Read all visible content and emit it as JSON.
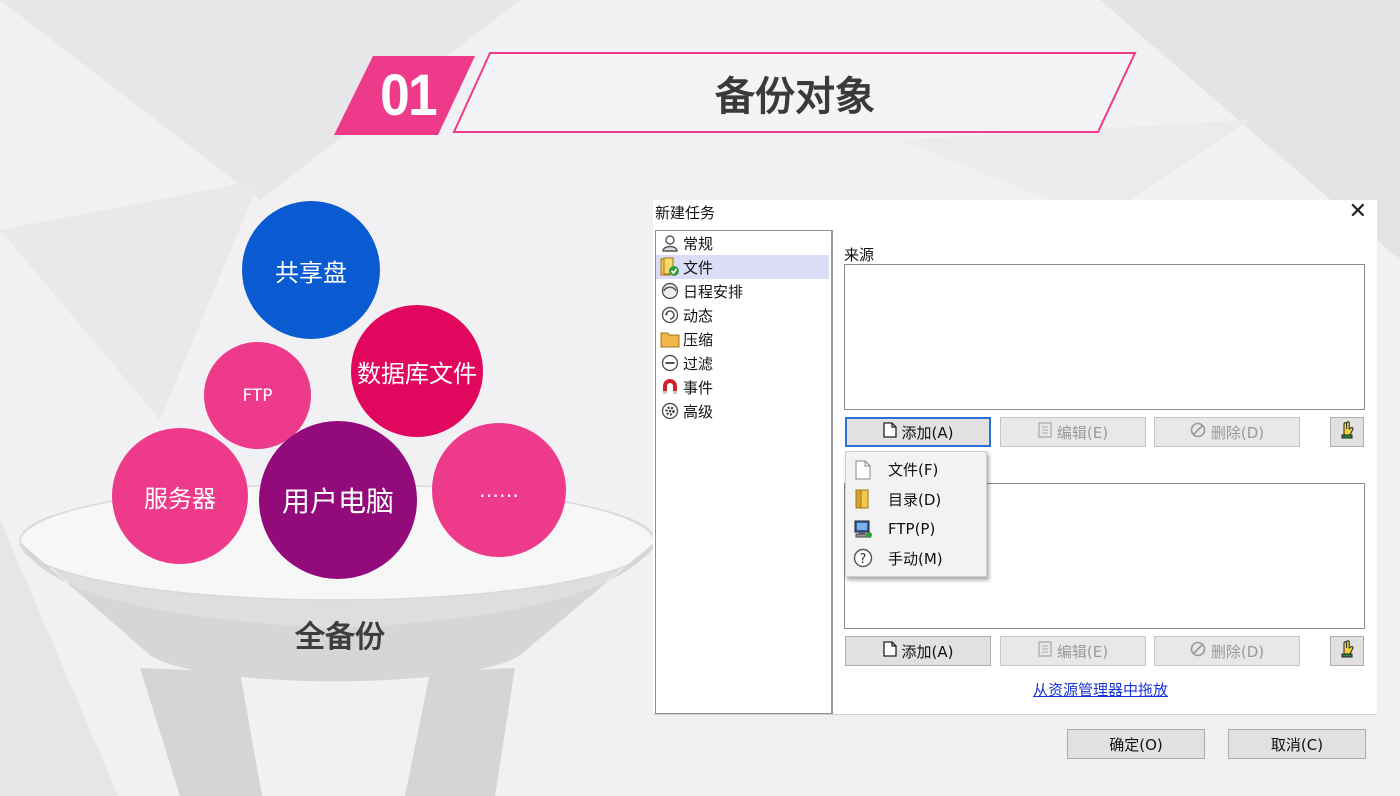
{
  "slide": {
    "number": "01",
    "title": "备份对象",
    "funnel_label": "全备份",
    "bubbles": [
      "共享盘",
      "数据库文件",
      "FTP",
      "服务器",
      "用户电脑",
      "……"
    ]
  },
  "colors": {
    "accent_pink": "#ee3a8a",
    "blue_bubble": "#0a5bd1",
    "crimson_bubble": "#e1065e",
    "pink_bubble": "#ee3a8a",
    "purple_bubble": "#930a7b",
    "link_blue": "#1a33d6"
  },
  "dialog": {
    "title": "新建任务",
    "close_symbol": "✕",
    "tree_items": [
      {
        "label": "常规",
        "icon": "user-icon"
      },
      {
        "label": "文件",
        "icon": "file-folder-check-icon",
        "selected": true
      },
      {
        "label": "日程安排",
        "icon": "clock-icon"
      },
      {
        "label": "动态",
        "icon": "refresh-icon"
      },
      {
        "label": "压缩",
        "icon": "archive-folder-icon"
      },
      {
        "label": "过滤",
        "icon": "minus-circle-icon"
      },
      {
        "label": "事件",
        "icon": "magnet-icon"
      },
      {
        "label": "高级",
        "icon": "gear-icon"
      }
    ],
    "source_label": "来源",
    "add_button": "添加(A)",
    "edit_button": "编辑(E)",
    "delete_button": "删除(D)",
    "drag_link": "从资源管理器中拖放",
    "ok_button": "确定(O)",
    "cancel_button": "取消(C)",
    "add_menu": [
      {
        "label": "文件(F)",
        "icon": "file-icon"
      },
      {
        "label": "目录(D)",
        "icon": "folder-icon"
      },
      {
        "label": "FTP(P)",
        "icon": "ftp-computer-icon"
      },
      {
        "label": "手动(M)",
        "icon": "help-icon"
      }
    ]
  }
}
